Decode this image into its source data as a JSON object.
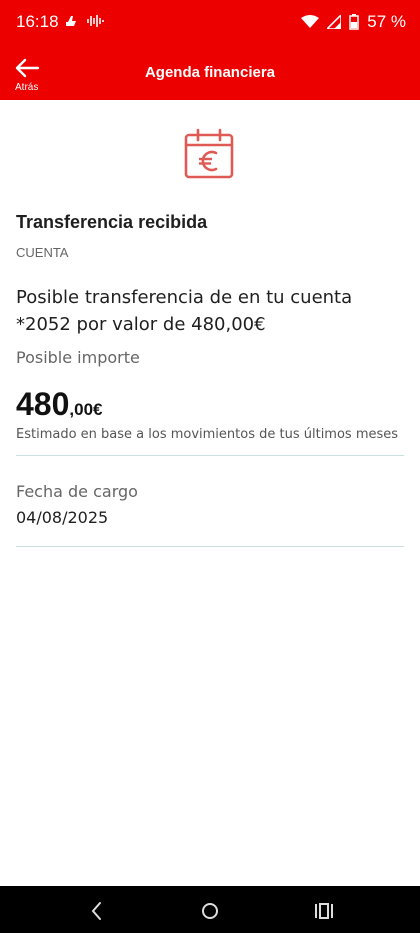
{
  "status_bar": {
    "time": "16:18",
    "battery": "57 %",
    "icons": [
      "hand-icon",
      "sound-wave-icon",
      "wifi-icon",
      "cell-signal-icon",
      "battery-icon"
    ]
  },
  "app_bar": {
    "back_label": "Atrás",
    "title": "Agenda financiera"
  },
  "detail": {
    "title": "Transferencia recibida",
    "category": "CUENTA",
    "description": "Posible transferencia de  en tu cuenta *2052 por valor de 480,00€",
    "amount_label": "Posible importe",
    "amount_int": "480",
    "amount_dec": ",00€",
    "amount_note": "Estimado en base a los movimientos de tus últimos meses",
    "date_label": "Fecha de cargo",
    "date_value": "04/08/2025"
  },
  "colors": {
    "brand_red": "#ec0000",
    "icon_red": "#e05a55",
    "divider": "#c9dfe0"
  }
}
